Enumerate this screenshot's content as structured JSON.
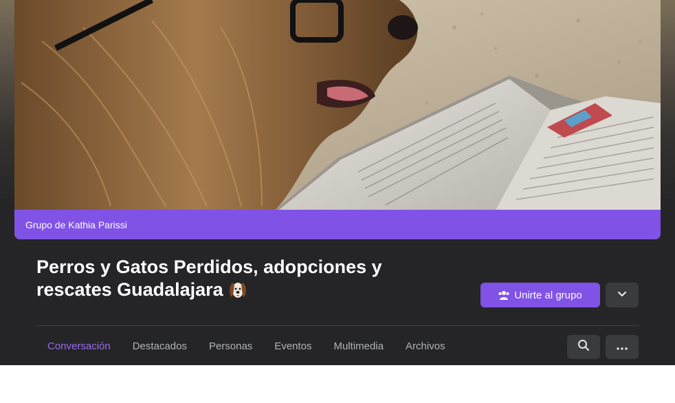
{
  "cover": {
    "alt": "dog-with-glasses-reading-book-on-beach-photo",
    "owner_label": "Grupo de Kathia Parissi"
  },
  "group": {
    "title": "Perros y Gatos Perdidos, adopciones y rescates Guadalajara",
    "title_emoji": "dog-face-emoji"
  },
  "actions": {
    "join_label": "Unirte al grupo",
    "join_icon": "people-icon",
    "dropdown_icon": "chevron-down-icon",
    "search_icon": "search-icon",
    "more_icon": "more-dots-icon"
  },
  "tabs": [
    {
      "label": "Conversación",
      "active": true
    },
    {
      "label": "Destacados",
      "active": false
    },
    {
      "label": "Personas",
      "active": false
    },
    {
      "label": "Eventos",
      "active": false
    },
    {
      "label": "Multimedia",
      "active": false
    },
    {
      "label": "Archivos",
      "active": false
    }
  ],
  "colors": {
    "accent": "#8052e6",
    "active_tab": "#9a6af2",
    "background": "#252527",
    "button_secondary": "#3a3b3c",
    "tab_text": "#b0b3b8"
  }
}
